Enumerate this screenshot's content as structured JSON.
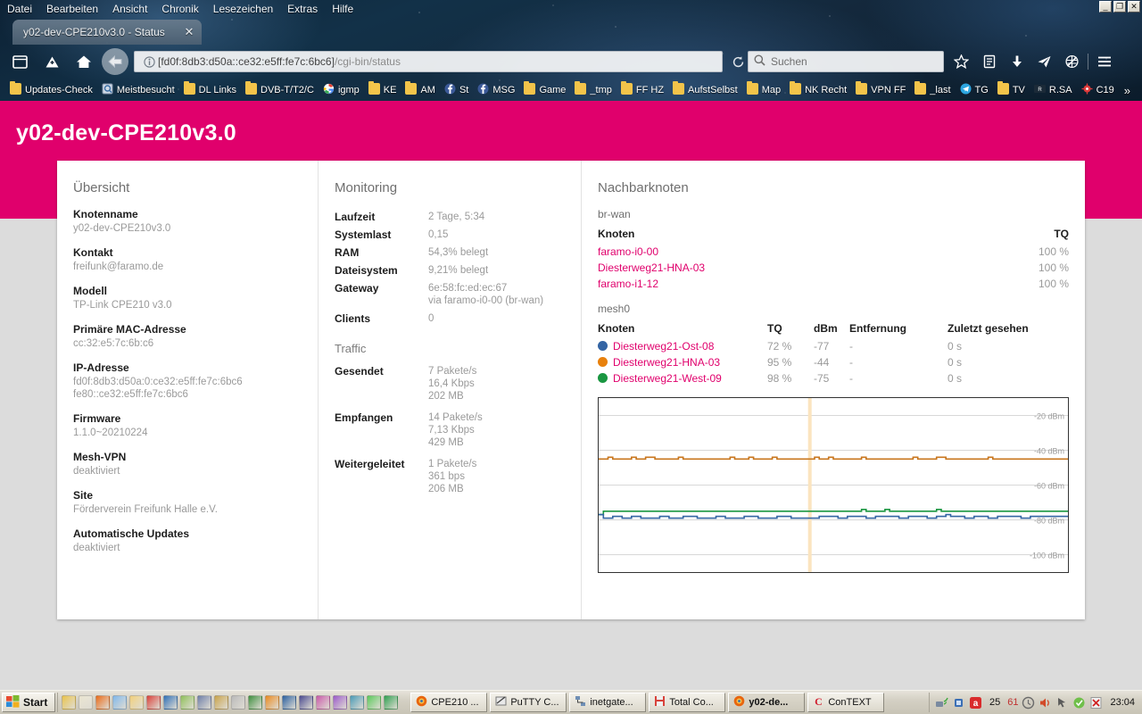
{
  "browser": {
    "menu": [
      "Datei",
      "Bearbeiten",
      "Ansicht",
      "Chronik",
      "Lesezeichen",
      "Extras",
      "Hilfe"
    ],
    "window_buttons": {
      "minimize": "_",
      "maximize": "❐",
      "close": "✕"
    },
    "tab": {
      "title": "y02-dev-CPE210v3.0 - Status",
      "close": "✕"
    },
    "url_host": "[fd0f:8db3:d50a::ce32:e5ff:fe7c:6bc6]",
    "url_path": "/cgi-bin/status",
    "search_placeholder": "Suchen",
    "bookmarks": [
      {
        "label": "Updates-Check",
        "icon": "folder-icon"
      },
      {
        "label": "Meistbesucht",
        "icon": "star-page-icon"
      },
      {
        "label": "DL Links",
        "icon": "folder-icon"
      },
      {
        "label": "DVB-T/T2/C",
        "icon": "folder-icon"
      },
      {
        "label": "igmp",
        "icon": "google-icon"
      },
      {
        "label": "KE",
        "icon": "folder-icon"
      },
      {
        "label": "AM",
        "icon": "folder-icon"
      },
      {
        "label": "St",
        "icon": "facebook-icon"
      },
      {
        "label": "MSG",
        "icon": "facebook-icon"
      },
      {
        "label": "Game",
        "icon": "folder-icon"
      },
      {
        "label": "_tmp",
        "icon": "folder-icon"
      },
      {
        "label": "FF HZ",
        "icon": "folder-icon"
      },
      {
        "label": "AufstSelbst",
        "icon": "folder-icon"
      },
      {
        "label": "Map",
        "icon": "folder-icon"
      },
      {
        "label": "NK Recht",
        "icon": "folder-icon"
      },
      {
        "label": "VPN FF",
        "icon": "folder-icon"
      },
      {
        "label": "_last",
        "icon": "folder-icon"
      },
      {
        "label": "TG",
        "icon": "telegram-icon"
      },
      {
        "label": "TV",
        "icon": "folder-icon"
      },
      {
        "label": "R.SA",
        "icon": "radio-icon"
      },
      {
        "label": "C19",
        "icon": "corona-icon"
      }
    ],
    "bookmarks_overflow": "»"
  },
  "page": {
    "title": "y02-dev-CPE210v3.0",
    "accent_color": "#e0006c",
    "overview": {
      "heading": "Übersicht",
      "items": [
        {
          "label": "Knotenname",
          "value": "y02-dev-CPE210v3.0"
        },
        {
          "label": "Kontakt",
          "value": "freifunk@faramo.de"
        },
        {
          "label": "Modell",
          "value": "TP-Link CPE210 v3.0"
        },
        {
          "label": "Primäre MAC-Adresse",
          "value": "cc:32:e5:7c:6b:c6"
        },
        {
          "label": "IP-Adresse",
          "value": "fd0f:8db3:d50a:0:ce32:e5ff:fe7c:6bc6\nfe80::ce32:e5ff:fe7c:6bc6"
        },
        {
          "label": "Firmware",
          "value": "1.1.0~20210224"
        },
        {
          "label": "Mesh-VPN",
          "value": "deaktiviert"
        },
        {
          "label": "Site",
          "value": "Förderverein Freifunk Halle e.V."
        },
        {
          "label": "Automatische Updates",
          "value": "deaktiviert"
        }
      ]
    },
    "monitoring": {
      "heading": "Monitoring",
      "rows": [
        {
          "label": "Laufzeit",
          "value": "2 Tage, 5:34"
        },
        {
          "label": "Systemlast",
          "value": "0,15"
        },
        {
          "label": "RAM",
          "value": "54,3% belegt"
        },
        {
          "label": "Dateisystem",
          "value": "9,21% belegt"
        },
        {
          "label": "Gateway",
          "value": "6e:58:fc:ed:ec:67\nvia faramo-i0-00 (br-wan)"
        },
        {
          "label": "Clients",
          "value": "0"
        }
      ],
      "traffic_heading": "Traffic",
      "traffic_rows": [
        {
          "label": "Gesendet",
          "value": "7 Pakete/s\n16,4 Kbps\n202 MB"
        },
        {
          "label": "Empfangen",
          "value": "14 Pakete/s\n7,13 Kbps\n429 MB"
        },
        {
          "label": "Weitergeleitet",
          "value": "1 Pakete/s\n361 bps\n206 MB"
        }
      ]
    },
    "neighbours": {
      "heading": "Nachbarknoten",
      "brwan": {
        "iface": "br-wan",
        "headers": {
          "node": "Knoten",
          "tq": "TQ"
        },
        "rows": [
          {
            "node": "faramo-i0-00",
            "tq": "100 %"
          },
          {
            "node": "Diesterweg21-HNA-03",
            "tq": "100 %"
          },
          {
            "node": "faramo-i1-12",
            "tq": "100 %"
          }
        ]
      },
      "mesh0": {
        "iface": "mesh0",
        "headers": {
          "node": "Knoten",
          "tq": "TQ",
          "dbm": "dBm",
          "dist": "Entfernung",
          "seen": "Zuletzt gesehen"
        },
        "rows": [
          {
            "color": "#3465a4",
            "node": "Diesterweg21-Ost-08",
            "tq": "72 %",
            "dbm": "-77",
            "dist": "-",
            "seen": "0 s"
          },
          {
            "color": "#e8810c",
            "node": "Diesterweg21-HNA-03",
            "tq": "95 %",
            "dbm": "-44",
            "dist": "-",
            "seen": "0 s"
          },
          {
            "color": "#1a9641",
            "node": "Diesterweg21-West-09",
            "tq": "98 %",
            "dbm": "-75",
            "dist": "-",
            "seen": "0 s"
          }
        ]
      }
    }
  },
  "chart_data": {
    "type": "line",
    "title": "",
    "xlabel": "",
    "ylabel": "dBm",
    "ylim": [
      -110,
      -10
    ],
    "ytick_labels": [
      "-20 dBm",
      "-40 dBm",
      "-60 dBm",
      "-80 dBm",
      "-100 dBm"
    ],
    "yticks": [
      -20,
      -40,
      -60,
      -80,
      -100
    ],
    "grid": true,
    "legend": "none",
    "marker_line_x_pct": 45,
    "series": [
      {
        "name": "Diesterweg21-HNA-03",
        "color": "#c8761e",
        "values": [
          -45,
          -45,
          -44,
          -45,
          -45,
          -45,
          -45,
          -44,
          -45,
          -45,
          -44,
          -44,
          -45,
          -45,
          -45,
          -45,
          -45,
          -44,
          -45,
          -45,
          -45,
          -45,
          -45,
          -45,
          -45,
          -45,
          -45,
          -45,
          -44,
          -45,
          -45,
          -45,
          -44,
          -45,
          -45,
          -45,
          -45,
          -44,
          -45,
          -45,
          -45,
          -45,
          -45,
          -45,
          -45,
          -45,
          -44,
          -45,
          -45,
          -44,
          -45,
          -45,
          -45,
          -45,
          -45,
          -45,
          -44,
          -45,
          -45,
          -45,
          -45,
          -45,
          -45,
          -45,
          -45,
          -45,
          -45,
          -44,
          -45,
          -45,
          -45,
          -45,
          -44,
          -44,
          -45,
          -45,
          -45,
          -45,
          -45,
          -45,
          -45,
          -45,
          -45,
          -44,
          -45,
          -45,
          -45,
          -45,
          -45,
          -45,
          -45,
          -45,
          -45,
          -45,
          -45,
          -45,
          -45,
          -45,
          -45,
          -45
        ]
      },
      {
        "name": "Diesterweg21-West-09",
        "color": "#1a9641",
        "values": [
          -77,
          -75,
          -75,
          -75,
          -75,
          -75,
          -75,
          -75,
          -75,
          -75,
          -75,
          -75,
          -75,
          -75,
          -75,
          -75,
          -75,
          -75,
          -75,
          -75,
          -75,
          -75,
          -75,
          -75,
          -75,
          -75,
          -75,
          -75,
          -75,
          -75,
          -75,
          -75,
          -75,
          -75,
          -75,
          -75,
          -75,
          -75,
          -75,
          -75,
          -75,
          -75,
          -75,
          -75,
          -75,
          -75,
          -75,
          -75,
          -75,
          -75,
          -75,
          -75,
          -75,
          -75,
          -75,
          -75,
          -74,
          -75,
          -75,
          -75,
          -75,
          -74,
          -75,
          -75,
          -75,
          -75,
          -75,
          -75,
          -75,
          -75,
          -75,
          -75,
          -74,
          -75,
          -75,
          -75,
          -75,
          -75,
          -75,
          -75,
          -75,
          -75,
          -75,
          -75,
          -75,
          -75,
          -75,
          -75,
          -75,
          -75,
          -75,
          -75,
          -75,
          -75,
          -75,
          -75,
          -75,
          -75,
          -75,
          -75
        ]
      },
      {
        "name": "Diesterweg21-Ost-08",
        "color": "#3465a4",
        "values": [
          -77,
          -79,
          -79,
          -78,
          -78,
          -79,
          -79,
          -78,
          -78,
          -79,
          -79,
          -79,
          -79,
          -78,
          -78,
          -79,
          -79,
          -79,
          -78,
          -78,
          -78,
          -79,
          -79,
          -79,
          -79,
          -78,
          -78,
          -79,
          -79,
          -79,
          -79,
          -78,
          -78,
          -78,
          -79,
          -79,
          -79,
          -79,
          -78,
          -78,
          -78,
          -79,
          -79,
          -79,
          -79,
          -79,
          -79,
          -78,
          -78,
          -78,
          -78,
          -79,
          -79,
          -78,
          -78,
          -78,
          -78,
          -79,
          -79,
          -78,
          -78,
          -78,
          -78,
          -78,
          -79,
          -79,
          -78,
          -78,
          -78,
          -78,
          -79,
          -79,
          -78,
          -78,
          -77,
          -78,
          -78,
          -78,
          -79,
          -79,
          -78,
          -78,
          -78,
          -79,
          -79,
          -78,
          -78,
          -78,
          -78,
          -78,
          -79,
          -79,
          -78,
          -78,
          -78,
          -78,
          -78,
          -78,
          -78,
          -78
        ]
      }
    ]
  },
  "taskbar": {
    "start": "Start",
    "quicklaunch": [
      "key-icon",
      "notepad-icon",
      "firefox-icon",
      "refresh-icon",
      "folder-icon",
      "save-icon",
      "v2-icon",
      "lock-icon",
      "network-icon",
      "search-icon",
      "webcam-icon",
      "tools-icon",
      "flame-icon",
      "wave-icon",
      "chip-icon",
      "paint-icon",
      "colors-icon",
      "eye-icon",
      "flower-icon",
      "arrow-icon"
    ],
    "tasks": [
      {
        "label": "CPE210 ...",
        "icon": "firefox-icon",
        "active": false
      },
      {
        "label": "PuTTY C...",
        "icon": "putty-icon",
        "active": false
      },
      {
        "label": "inetgate...",
        "icon": "network-icon",
        "active": false
      },
      {
        "label": "Total Co...",
        "icon": "save-icon",
        "active": false
      },
      {
        "label": "y02-de...",
        "icon": "firefox-icon",
        "active": true
      },
      {
        "label": "ConTEXT",
        "icon": "context-icon",
        "active": false
      }
    ],
    "tray_numbers": [
      "25",
      "61"
    ],
    "clock": "23:04"
  }
}
